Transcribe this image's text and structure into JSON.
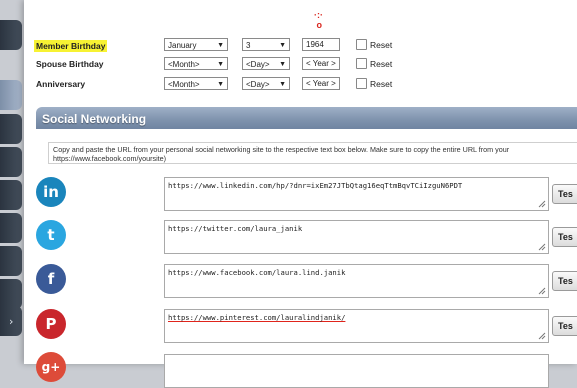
{
  "dates": {
    "member_birthday": {
      "label": "Member Birthday",
      "month": "January",
      "day": "3",
      "year": "1964",
      "reset": "Reset"
    },
    "spouse_birthday": {
      "label": "Spouse Birthday",
      "month": "<Month>",
      "day": "<Day>",
      "year": "< Year >",
      "reset": "Reset"
    },
    "anniversary": {
      "label": "Anniversary",
      "month": "<Month>",
      "day": "<Day>",
      "year": "< Year >",
      "reset": "Reset"
    }
  },
  "social": {
    "section_title": "Social Networking",
    "instructions": "Copy and paste the URL from your personal social networking site to the respective text box below. Make sure to copy the entire URL from your https://www.facebook.com/yoursite)",
    "items": [
      {
        "network": "linkedin",
        "icon_glyph": "in",
        "color": "#1a85bc",
        "url": "https://www.linkedin.com/hp/?dnr=ixEm27JTbQtag16eqTtmBqvTCiIzguN6PDT",
        "button": "Tes"
      },
      {
        "network": "twitter",
        "icon_glyph": "t",
        "color": "#2aa6e0",
        "url": "https://twitter.com/laura_janik",
        "button": "Tes"
      },
      {
        "network": "facebook",
        "icon_glyph": "f",
        "color": "#3a5a98",
        "url": "https://www.facebook.com/laura.lind.janik",
        "button": "Tes"
      },
      {
        "network": "pinterest",
        "icon_glyph": "P",
        "color": "#c9262c",
        "url": "https://www.pinterest.com/lauralindjanik/",
        "button": "Tes"
      },
      {
        "network": "googleplus",
        "icon_glyph": "g+",
        "color": "#dd4b39",
        "url": "",
        "button": ""
      }
    ]
  },
  "colors": {
    "highlight": "#f7f233",
    "section_bar": "#7e92ad",
    "tab_dark": "#2b3440"
  }
}
